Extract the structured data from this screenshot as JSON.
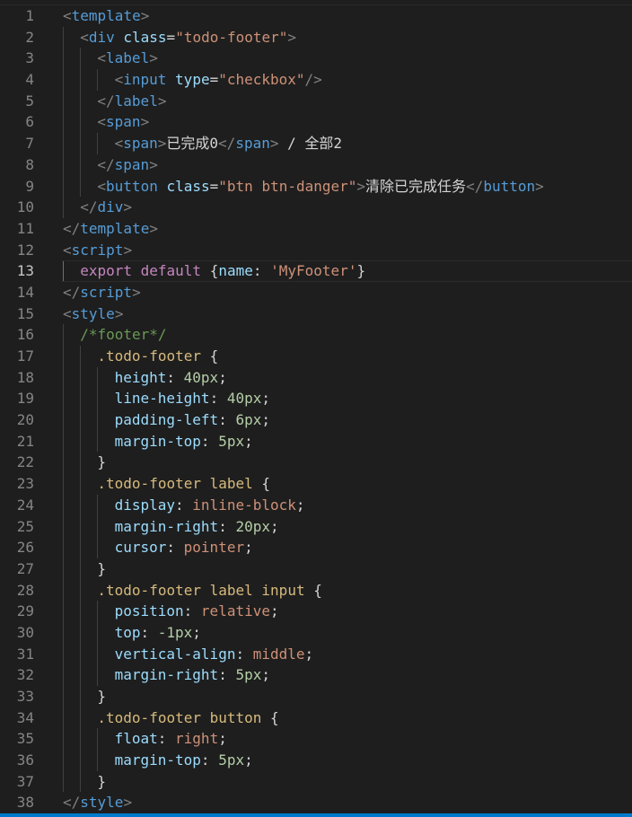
{
  "editor": {
    "active_line": 13,
    "lines": [
      {
        "n": "1",
        "indent": 0,
        "tokens": [
          [
            "t-punct",
            "<"
          ],
          [
            "t-tag",
            "template"
          ],
          [
            "t-punct",
            ">"
          ]
        ]
      },
      {
        "n": "2",
        "indent": 1,
        "tokens": [
          [
            "t-punct",
            "<"
          ],
          [
            "t-tag",
            "div"
          ],
          [
            "t-text",
            " "
          ],
          [
            "t-attr",
            "class"
          ],
          [
            "t-text",
            "="
          ],
          [
            "t-str",
            "\"todo-footer\""
          ],
          [
            "t-punct",
            ">"
          ]
        ]
      },
      {
        "n": "3",
        "indent": 2,
        "tokens": [
          [
            "t-punct",
            "<"
          ],
          [
            "t-tag",
            "label"
          ],
          [
            "t-punct",
            ">"
          ]
        ]
      },
      {
        "n": "4",
        "indent": 3,
        "tokens": [
          [
            "t-punct",
            "<"
          ],
          [
            "t-tag",
            "input"
          ],
          [
            "t-text",
            " "
          ],
          [
            "t-attr",
            "type"
          ],
          [
            "t-text",
            "="
          ],
          [
            "t-str",
            "\"checkbox\""
          ],
          [
            "t-punct",
            "/>"
          ]
        ]
      },
      {
        "n": "5",
        "indent": 2,
        "tokens": [
          [
            "t-punct",
            "</"
          ],
          [
            "t-tag",
            "label"
          ],
          [
            "t-punct",
            ">"
          ]
        ]
      },
      {
        "n": "6",
        "indent": 2,
        "tokens": [
          [
            "t-punct",
            "<"
          ],
          [
            "t-tag",
            "span"
          ],
          [
            "t-punct",
            ">"
          ]
        ]
      },
      {
        "n": "7",
        "indent": 3,
        "tokens": [
          [
            "t-punct",
            "<"
          ],
          [
            "t-tag",
            "span"
          ],
          [
            "t-punct",
            ">"
          ],
          [
            "t-text",
            "已完成0"
          ],
          [
            "t-punct",
            "</"
          ],
          [
            "t-tag",
            "span"
          ],
          [
            "t-punct",
            ">"
          ],
          [
            "t-text",
            " / 全部2"
          ]
        ]
      },
      {
        "n": "8",
        "indent": 2,
        "tokens": [
          [
            "t-punct",
            "</"
          ],
          [
            "t-tag",
            "span"
          ],
          [
            "t-punct",
            ">"
          ]
        ]
      },
      {
        "n": "9",
        "indent": 2,
        "tokens": [
          [
            "t-punct",
            "<"
          ],
          [
            "t-tag",
            "button"
          ],
          [
            "t-text",
            " "
          ],
          [
            "t-attr",
            "class"
          ],
          [
            "t-text",
            "="
          ],
          [
            "t-str",
            "\"btn btn-danger\""
          ],
          [
            "t-punct",
            ">"
          ],
          [
            "t-text",
            "清除已完成任务"
          ],
          [
            "t-punct",
            "</"
          ],
          [
            "t-tag",
            "button"
          ],
          [
            "t-punct",
            ">"
          ]
        ]
      },
      {
        "n": "10",
        "indent": 1,
        "tokens": [
          [
            "t-punct",
            "</"
          ],
          [
            "t-tag",
            "div"
          ],
          [
            "t-punct",
            ">"
          ]
        ]
      },
      {
        "n": "11",
        "indent": 0,
        "tokens": [
          [
            "t-punct",
            "</"
          ],
          [
            "t-tag",
            "template"
          ],
          [
            "t-punct",
            ">"
          ]
        ]
      },
      {
        "n": "12",
        "indent": 0,
        "tokens": [
          [
            "t-punct",
            "<"
          ],
          [
            "t-tag",
            "script"
          ],
          [
            "t-punct",
            ">"
          ]
        ]
      },
      {
        "n": "13",
        "indent": 1,
        "tokens": [
          [
            "t-kw",
            "export"
          ],
          [
            "t-text",
            " "
          ],
          [
            "t-kw",
            "default"
          ],
          [
            "t-text",
            " {"
          ],
          [
            "t-key",
            "name"
          ],
          [
            "t-text",
            ": "
          ],
          [
            "t-str",
            "'MyFooter'"
          ],
          [
            "t-text",
            "}"
          ]
        ]
      },
      {
        "n": "14",
        "indent": 0,
        "tokens": [
          [
            "t-punct",
            "</"
          ],
          [
            "t-tag",
            "script"
          ],
          [
            "t-punct",
            ">"
          ]
        ]
      },
      {
        "n": "15",
        "indent": 0,
        "tokens": [
          [
            "t-punct",
            "<"
          ],
          [
            "t-tag",
            "style"
          ],
          [
            "t-punct",
            ">"
          ]
        ]
      },
      {
        "n": "16",
        "indent": 1,
        "tokens": [
          [
            "t-comment",
            "/*footer*/"
          ]
        ]
      },
      {
        "n": "17",
        "indent": 2,
        "tokens": [
          [
            "t-sel",
            ".todo-footer"
          ],
          [
            "t-text",
            " {"
          ]
        ]
      },
      {
        "n": "18",
        "indent": 3,
        "tokens": [
          [
            "t-prop",
            "height"
          ],
          [
            "t-text",
            ": "
          ],
          [
            "t-num",
            "40px"
          ],
          [
            "t-text",
            ";"
          ]
        ]
      },
      {
        "n": "19",
        "indent": 3,
        "tokens": [
          [
            "t-prop",
            "line-height"
          ],
          [
            "t-text",
            ": "
          ],
          [
            "t-num",
            "40px"
          ],
          [
            "t-text",
            ";"
          ]
        ]
      },
      {
        "n": "20",
        "indent": 3,
        "tokens": [
          [
            "t-prop",
            "padding-left"
          ],
          [
            "t-text",
            ": "
          ],
          [
            "t-num",
            "6px"
          ],
          [
            "t-text",
            ";"
          ]
        ]
      },
      {
        "n": "21",
        "indent": 3,
        "tokens": [
          [
            "t-prop",
            "margin-top"
          ],
          [
            "t-text",
            ": "
          ],
          [
            "t-num",
            "5px"
          ],
          [
            "t-text",
            ";"
          ]
        ]
      },
      {
        "n": "22",
        "indent": 2,
        "tokens": [
          [
            "t-text",
            "}"
          ]
        ]
      },
      {
        "n": "23",
        "indent": 2,
        "tokens": [
          [
            "t-sel",
            ".todo-footer label"
          ],
          [
            "t-text",
            " {"
          ]
        ]
      },
      {
        "n": "24",
        "indent": 3,
        "tokens": [
          [
            "t-prop",
            "display"
          ],
          [
            "t-text",
            ": "
          ],
          [
            "t-val",
            "inline-block"
          ],
          [
            "t-text",
            ";"
          ]
        ]
      },
      {
        "n": "25",
        "indent": 3,
        "tokens": [
          [
            "t-prop",
            "margin-right"
          ],
          [
            "t-text",
            ": "
          ],
          [
            "t-num",
            "20px"
          ],
          [
            "t-text",
            ";"
          ]
        ]
      },
      {
        "n": "26",
        "indent": 3,
        "tokens": [
          [
            "t-prop",
            "cursor"
          ],
          [
            "t-text",
            ": "
          ],
          [
            "t-val",
            "pointer"
          ],
          [
            "t-text",
            ";"
          ]
        ]
      },
      {
        "n": "27",
        "indent": 2,
        "tokens": [
          [
            "t-text",
            "}"
          ]
        ]
      },
      {
        "n": "28",
        "indent": 2,
        "tokens": [
          [
            "t-sel",
            ".todo-footer label input"
          ],
          [
            "t-text",
            " {"
          ]
        ]
      },
      {
        "n": "29",
        "indent": 3,
        "tokens": [
          [
            "t-prop",
            "position"
          ],
          [
            "t-text",
            ": "
          ],
          [
            "t-val",
            "relative"
          ],
          [
            "t-text",
            ";"
          ]
        ]
      },
      {
        "n": "30",
        "indent": 3,
        "tokens": [
          [
            "t-prop",
            "top"
          ],
          [
            "t-text",
            ": "
          ],
          [
            "t-num",
            "-1px"
          ],
          [
            "t-text",
            ";"
          ]
        ]
      },
      {
        "n": "31",
        "indent": 3,
        "tokens": [
          [
            "t-prop",
            "vertical-align"
          ],
          [
            "t-text",
            ": "
          ],
          [
            "t-val",
            "middle"
          ],
          [
            "t-text",
            ";"
          ]
        ]
      },
      {
        "n": "32",
        "indent": 3,
        "tokens": [
          [
            "t-prop",
            "margin-right"
          ],
          [
            "t-text",
            ": "
          ],
          [
            "t-num",
            "5px"
          ],
          [
            "t-text",
            ";"
          ]
        ]
      },
      {
        "n": "33",
        "indent": 2,
        "tokens": [
          [
            "t-text",
            "}"
          ]
        ]
      },
      {
        "n": "34",
        "indent": 2,
        "tokens": [
          [
            "t-sel",
            ".todo-footer button"
          ],
          [
            "t-text",
            " {"
          ]
        ]
      },
      {
        "n": "35",
        "indent": 3,
        "tokens": [
          [
            "t-prop",
            "float"
          ],
          [
            "t-text",
            ": "
          ],
          [
            "t-val",
            "right"
          ],
          [
            "t-text",
            ";"
          ]
        ]
      },
      {
        "n": "36",
        "indent": 3,
        "tokens": [
          [
            "t-prop",
            "margin-top"
          ],
          [
            "t-text",
            ": "
          ],
          [
            "t-num",
            "5px"
          ],
          [
            "t-text",
            ";"
          ]
        ]
      },
      {
        "n": "37",
        "indent": 2,
        "tokens": [
          [
            "t-text",
            "}"
          ]
        ]
      },
      {
        "n": "38",
        "indent": 0,
        "tokens": [
          [
            "t-punct",
            "</"
          ],
          [
            "t-tag",
            "style"
          ],
          [
            "t-punct",
            ">"
          ]
        ]
      }
    ]
  },
  "colors": {
    "background": "#1e1e1e",
    "status_bar": "#007acc",
    "tag": "#569cd6",
    "string": "#ce9178",
    "attribute": "#9cdcfe",
    "comment": "#6a9955",
    "selector": "#d7ba7d",
    "number": "#b5cea8",
    "keyword": "#c586c0"
  }
}
